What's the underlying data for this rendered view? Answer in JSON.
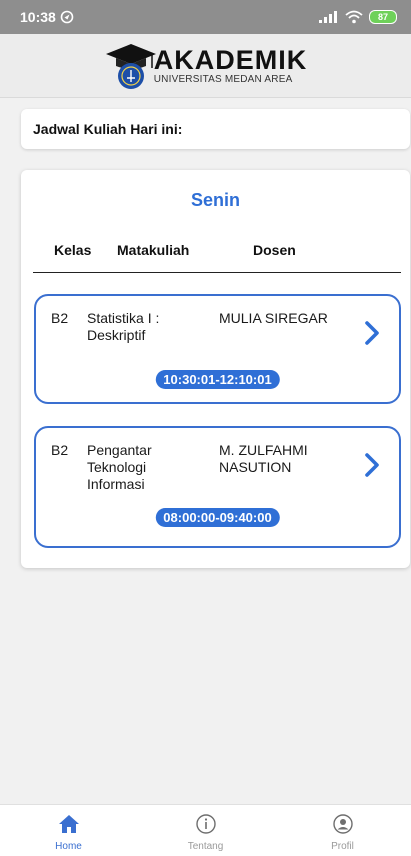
{
  "status_bar": {
    "time": "10:38",
    "battery": "87"
  },
  "header": {
    "title": "AKADEMIK",
    "subtitle": "UNIVERSITAS MEDAN AREA"
  },
  "today": {
    "label": "Jadwal Kuliah Hari ini:"
  },
  "schedule": {
    "day": "Senin",
    "columns": {
      "kelas": "Kelas",
      "matakuliah": "Matakuliah",
      "dosen": "Dosen"
    },
    "courses": [
      {
        "kelas": "B2",
        "matakuliah": "Statistika I : Deskriptif",
        "dosen": "MULIA SIREGAR",
        "time": "10:30:01-12:10:01"
      },
      {
        "kelas": "B2",
        "matakuliah": "Pengantar Teknologi Informasi",
        "dosen": "M. ZULFAHMI NASUTION",
        "time": "08:00:00-09:40:00"
      }
    ]
  },
  "nav": {
    "items": [
      {
        "label": "Home",
        "icon": "home-icon"
      },
      {
        "label": "Tentang",
        "icon": "info-icon"
      },
      {
        "label": "Profil",
        "icon": "profile-icon"
      }
    ]
  },
  "colors": {
    "accent": "#2f6fd6",
    "status_bar": "#8e8e8e",
    "battery": "#6fd15a"
  }
}
